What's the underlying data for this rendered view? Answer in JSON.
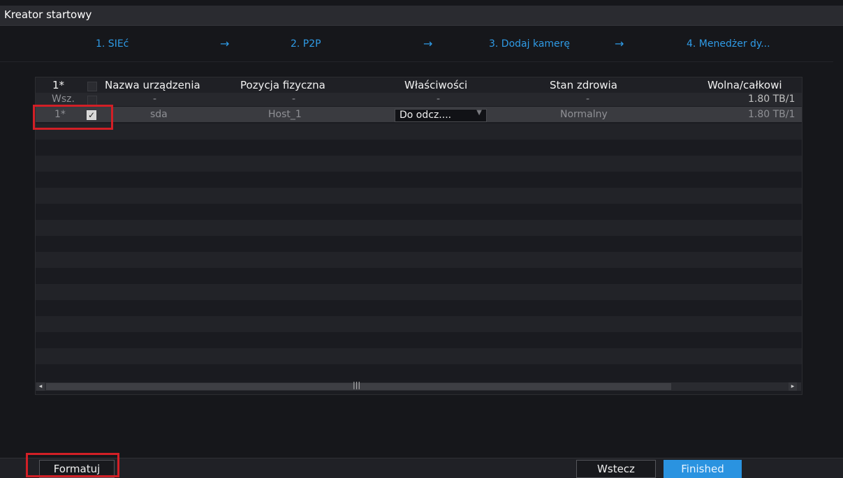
{
  "window": {
    "title": "Kreator startowy"
  },
  "steps": [
    {
      "label": "1.  SIEć"
    },
    {
      "label": "2.  P2P"
    },
    {
      "label": "3.  Dodaj kamerę"
    },
    {
      "label": "4.  Menedżer dy..."
    }
  ],
  "step_arrow": "→",
  "table": {
    "headers": {
      "index": "1*",
      "name": "Nazwa urządzenia",
      "position": "Pozycja fizyczna",
      "properties": "Właściwości",
      "health": "Stan zdrowia",
      "capacity": "Wolna/całkowi"
    },
    "all_row": {
      "index": "Wsz.",
      "name": "-",
      "position": "-",
      "properties": "-",
      "health": "-",
      "capacity": "1.80 TB/1"
    },
    "rows": [
      {
        "index": "1*",
        "checked_mark": "✓",
        "name": "sda",
        "position": "Host_1",
        "properties": "Do odcz....",
        "health": "Normalny",
        "capacity": "1.80 TB/1"
      }
    ]
  },
  "scrollbar": {
    "left_arrow": "◂",
    "grip": "|||",
    "right_arrow": "▸"
  },
  "buttons": {
    "format": "Formatuj",
    "back": "Wstecz",
    "finish": "Finished"
  },
  "colors": {
    "accent": "#2f9be6",
    "highlight": "#d21f26",
    "background": "#16171b"
  }
}
